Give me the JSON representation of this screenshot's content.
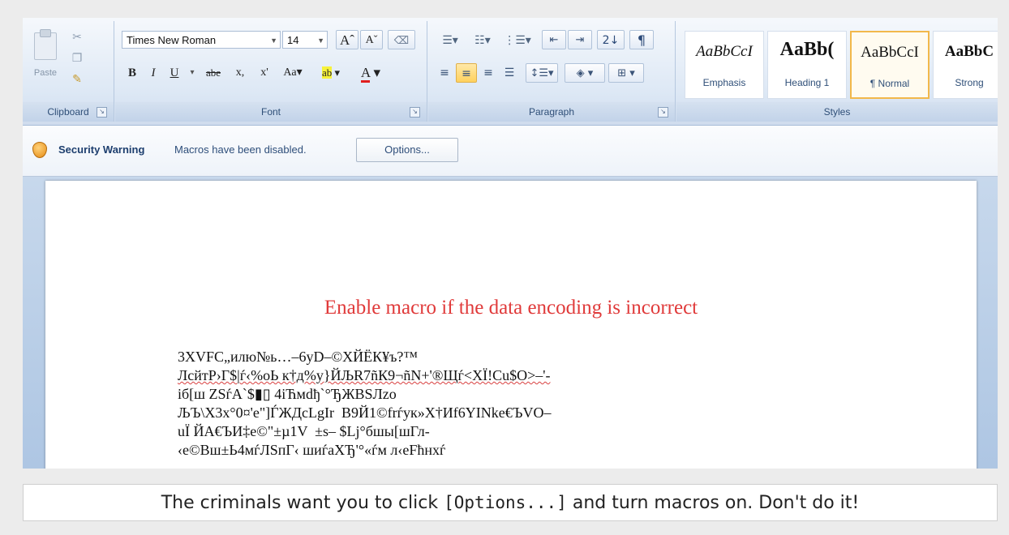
{
  "ribbon": {
    "clipboard": {
      "label": "Clipboard",
      "paste_label": "Paste",
      "cut_icon": "scissors-icon",
      "copy_icon": "copy-icon",
      "format_painter_icon": "brush-icon"
    },
    "font": {
      "label": "Font",
      "font_name": "Times New Roman",
      "font_size": "14",
      "grow_label": "A",
      "shrink_label": "A",
      "bold_label": "B",
      "italic_label": "I",
      "underline_label": "U",
      "strike_label": "abe",
      "subscript_label": "x,",
      "superscript_label": "x'",
      "case_label": "Aa",
      "highlight_label": "ab",
      "color_label": "A"
    },
    "paragraph": {
      "label": "Paragraph",
      "sort_label": "2↓",
      "pilcrow_label": "¶"
    },
    "styles": {
      "label": "Styles",
      "items": [
        {
          "sample": "AaBbCcI",
          "name": "Emphasis"
        },
        {
          "sample": "AaBb(",
          "name": "Heading 1"
        },
        {
          "sample": "AaBbCcI",
          "name": "¶ Normal"
        },
        {
          "sample": "AaBbC",
          "name": "Strong"
        }
      ]
    }
  },
  "security_bar": {
    "title": "Security Warning",
    "message": "Macros have been disabled.",
    "options_label": "Options..."
  },
  "document": {
    "enable_text": "Enable macro if the data encoding is incorrect",
    "garbled_lines": [
      "3XVFC„илю№ь…–6yD–©ХЙЁК¥ъ?™",
      "ЛсйтР›Г$|ѓ‹%оЬ к†д%у}ЙЉR7ñК9¬ñN+'®Щѓ<ХЇ!Сu$О>–'-",
      "iб[ш ZSѓA`$▮▯ 4iЋмdђ`°ЂЖBSЛzо",
      "ЉЪ\\X3x°0¤'e\"]ЃЖДсLgIr  В9Й1©frѓук»X†Иf6YINkе€ЪVO–",
      "uЇ ЙА€ЪИ‡е©\"±µ1V  ±s– $Lj°бшы[шГл-",
      "‹е©Вш±Ь4мѓЛSпГ‹ шиѓаХЂ'°«ѓм л‹еFћнхѓ"
    ]
  },
  "caption": {
    "before": "The criminals want you to click ",
    "code": "[Options...]",
    "after": " and turn macros on. Don't do it!"
  }
}
